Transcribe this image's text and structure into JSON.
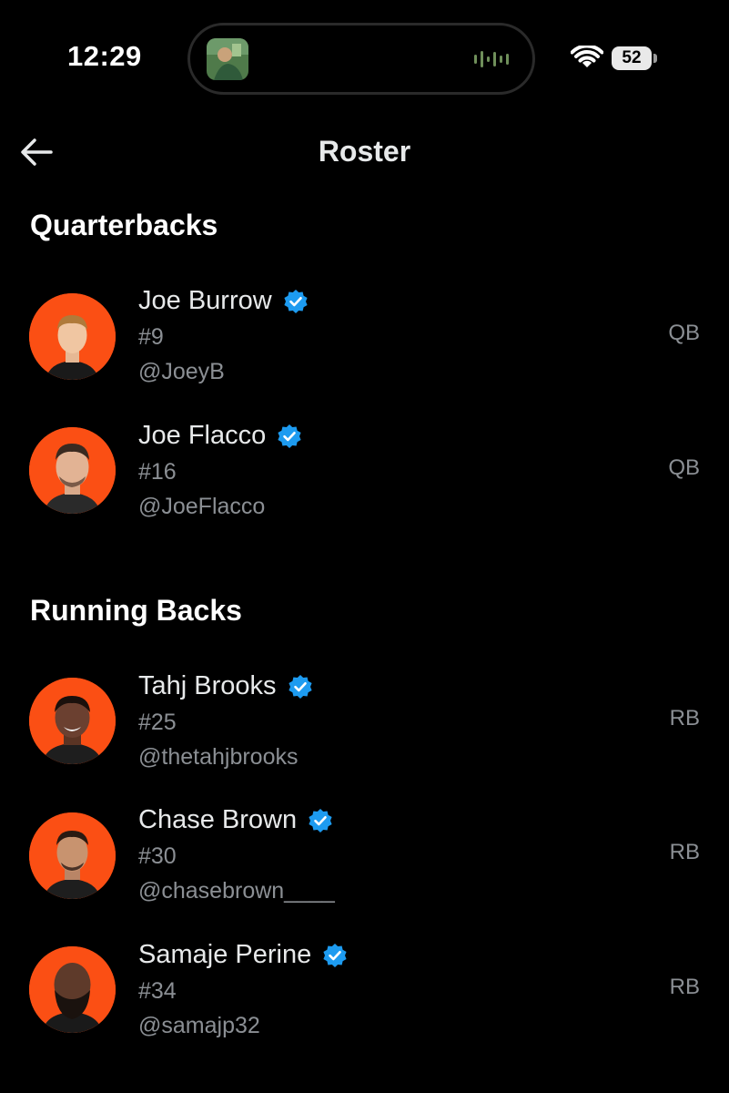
{
  "status_bar": {
    "time": "12:29",
    "battery": "52"
  },
  "header": {
    "title": "Roster"
  },
  "sections": [
    {
      "title": "Quarterbacks",
      "players": [
        {
          "name": "Joe Burrow",
          "number": "#9",
          "handle": "@JoeyB",
          "position": "QB"
        },
        {
          "name": "Joe Flacco",
          "number": "#16",
          "handle": "@JoeFlacco",
          "position": "QB"
        }
      ]
    },
    {
      "title": "Running Backs",
      "players": [
        {
          "name": "Tahj Brooks",
          "number": "#25",
          "handle": "@thetahjbrooks",
          "position": "RB"
        },
        {
          "name": "Chase Brown",
          "number": "#30",
          "handle": "@chasebrown____",
          "position": "RB"
        },
        {
          "name": "Samaje Perine",
          "number": "#34",
          "handle": "@samajp32",
          "position": "RB"
        }
      ]
    }
  ],
  "colors": {
    "avatar_bg": "#fb4f14",
    "verified": "#1d9bf0",
    "secondary_text": "#8b8f94"
  }
}
